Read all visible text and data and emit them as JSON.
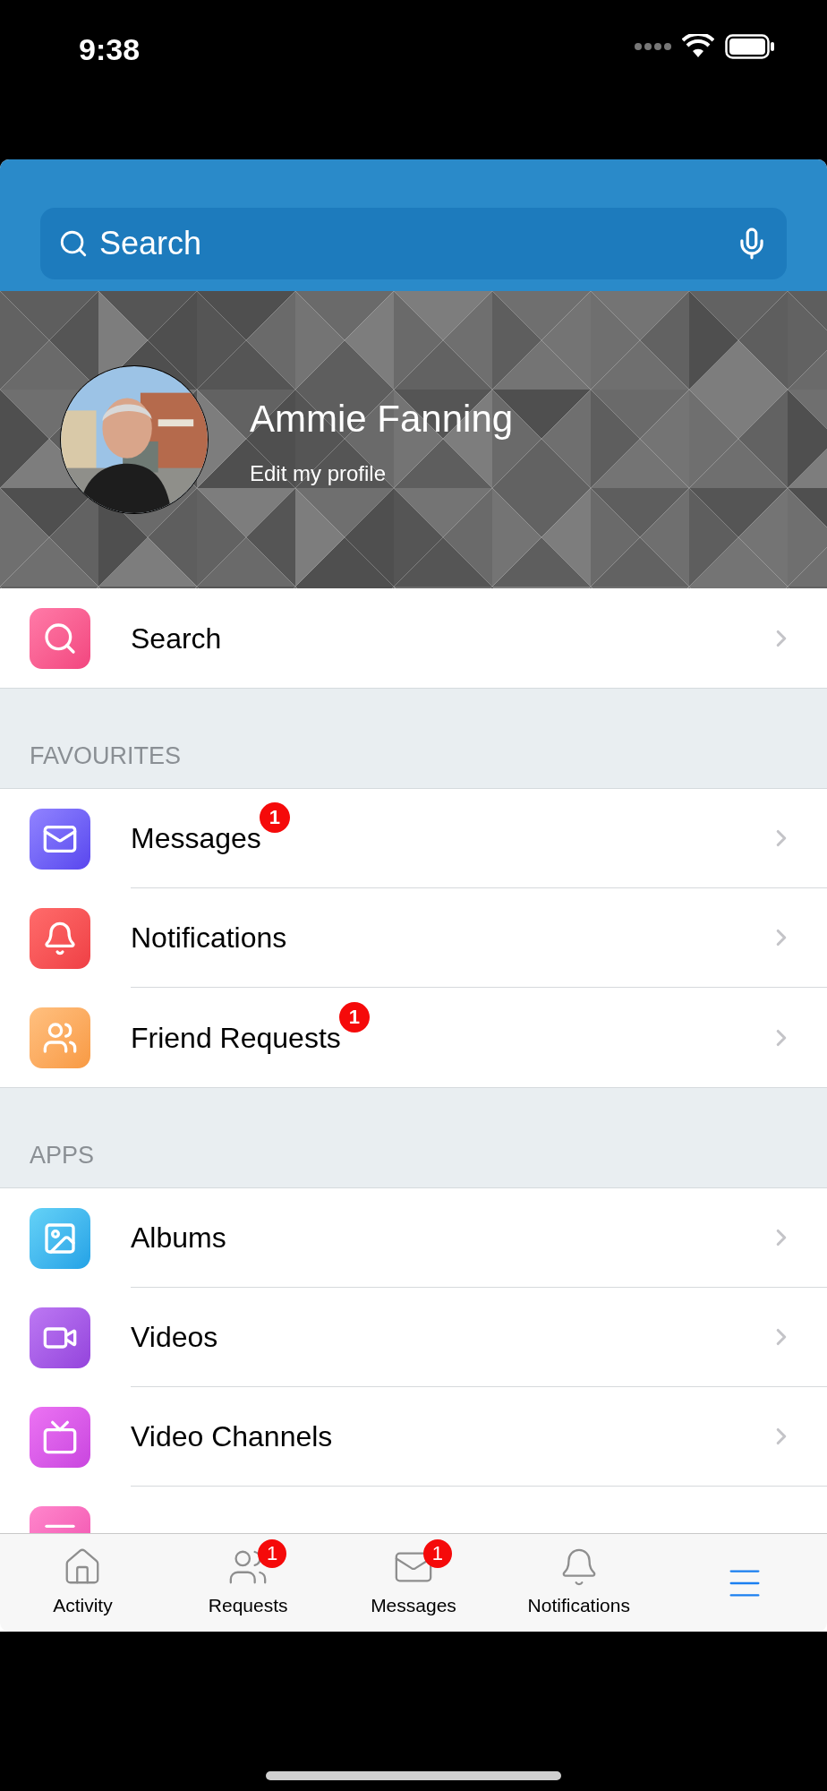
{
  "status_bar": {
    "time": "9:38"
  },
  "search_bar": {
    "placeholder": "Search"
  },
  "profile": {
    "name": "Ammie Fanning",
    "link": "Edit my profile"
  },
  "sections": [
    {
      "items": [
        {
          "label": "Search",
          "kind": "search"
        }
      ]
    },
    {
      "title": "FAVOURITES",
      "items": [
        {
          "label": "Messages",
          "kind": "mail",
          "badge": "1"
        },
        {
          "label": "Notifications",
          "kind": "bell"
        },
        {
          "label": "Friend Requests",
          "kind": "people",
          "badge": "1"
        }
      ]
    },
    {
      "title": "APPS",
      "items": [
        {
          "label": "Albums",
          "kind": "album"
        },
        {
          "label": "Videos",
          "kind": "video"
        },
        {
          "label": "Video Channels",
          "kind": "tv"
        },
        {
          "kind": "playlist"
        }
      ]
    }
  ],
  "tab_bar": [
    {
      "label": "Activity",
      "kind": "home",
      "selected": false
    },
    {
      "label": "Requests",
      "kind": "people",
      "badge": "1",
      "selected": false
    },
    {
      "label": "Messages",
      "kind": "mail",
      "badge": "1",
      "selected": false
    },
    {
      "label": "Notifications",
      "kind": "bell",
      "selected": false
    },
    {
      "kind": "menu",
      "selected": true
    }
  ]
}
